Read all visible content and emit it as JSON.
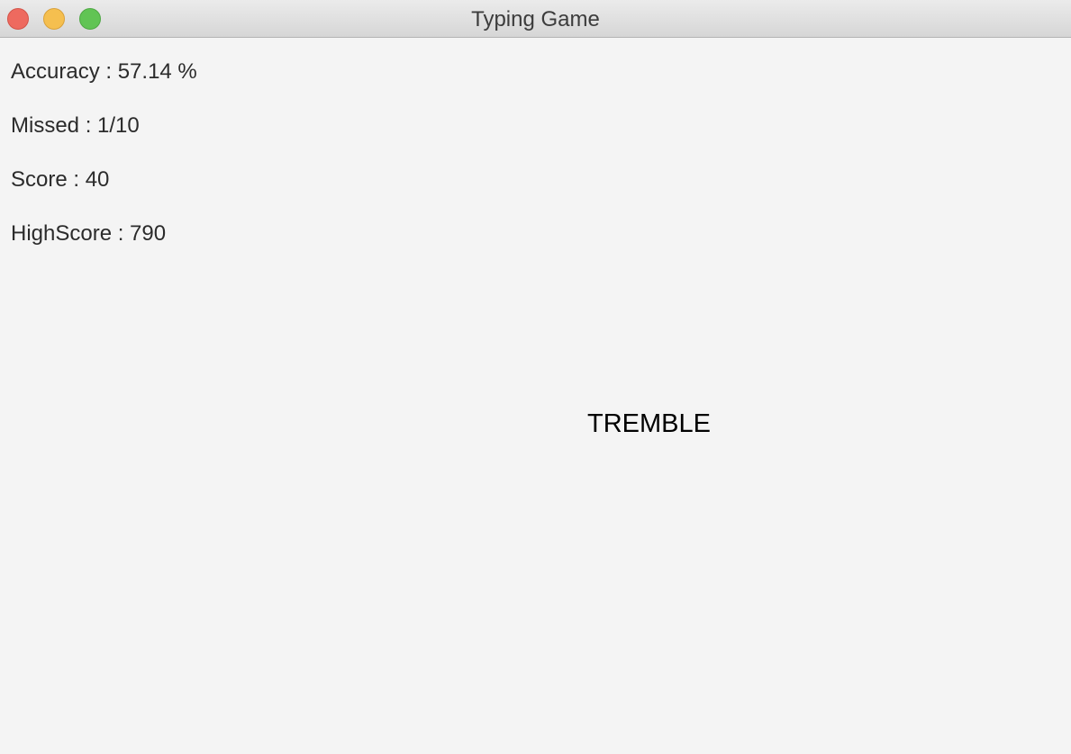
{
  "window": {
    "title": "Typing Game"
  },
  "stats": {
    "accuracy": "Accuracy : 57.14 %",
    "missed": "Missed : 1/10",
    "score": "Score : 40",
    "highscore": "HighScore : 790"
  },
  "game": {
    "current_word": "TREMBLE"
  },
  "colors": {
    "background": "#f4f4f4",
    "close": "#ee6a5f",
    "minimize": "#f5bf4f",
    "maximize": "#61c454"
  }
}
